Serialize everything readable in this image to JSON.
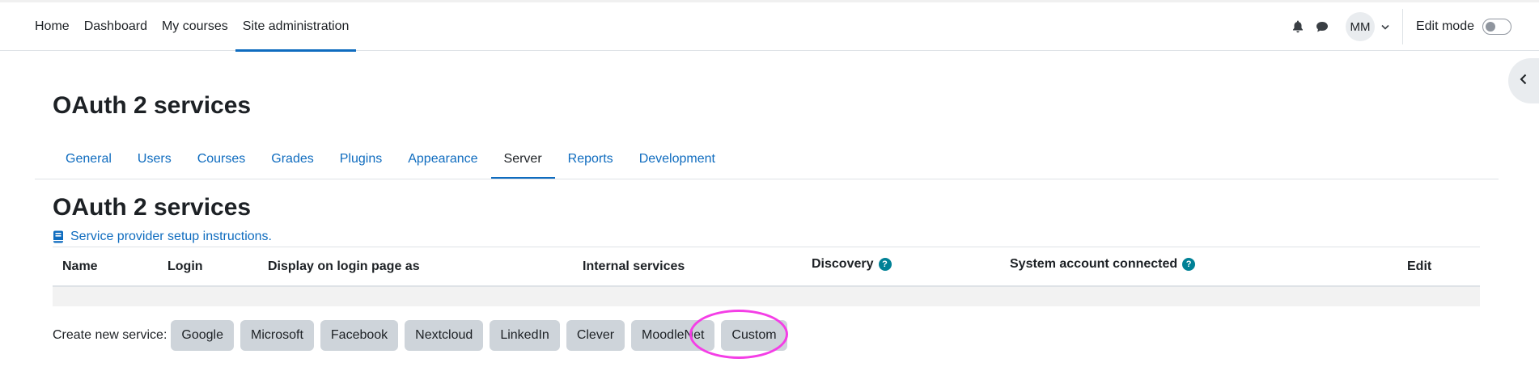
{
  "navbar": {
    "items": [
      {
        "label": "Home"
      },
      {
        "label": "Dashboard"
      },
      {
        "label": "My courses"
      },
      {
        "label": "Site administration",
        "active": true
      }
    ],
    "user_initials": "MM",
    "edit_mode_label": "Edit mode",
    "edit_mode_on": false
  },
  "page": {
    "heading": "OAuth 2 services"
  },
  "tabs": [
    {
      "label": "General"
    },
    {
      "label": "Users"
    },
    {
      "label": "Courses"
    },
    {
      "label": "Grades"
    },
    {
      "label": "Plugins"
    },
    {
      "label": "Appearance"
    },
    {
      "label": "Server",
      "active": true
    },
    {
      "label": "Reports"
    },
    {
      "label": "Development"
    }
  ],
  "content": {
    "heading": "OAuth 2 services",
    "setup_link": "Service provider setup instructions.",
    "table_headers": {
      "name": "Name",
      "login": "Login",
      "display": "Display on login page as",
      "internal": "Internal services",
      "discovery": "Discovery",
      "system_account": "System account connected",
      "edit": "Edit"
    },
    "help_glyph": "?",
    "create_label": "Create new service:",
    "services": [
      "Google",
      "Microsoft",
      "Facebook",
      "Nextcloud",
      "LinkedIn",
      "Clever",
      "MoodleNet",
      "Custom"
    ]
  },
  "colors": {
    "brand": "#0f6cbf",
    "help": "#008196",
    "highlight": "#f43ee6"
  }
}
